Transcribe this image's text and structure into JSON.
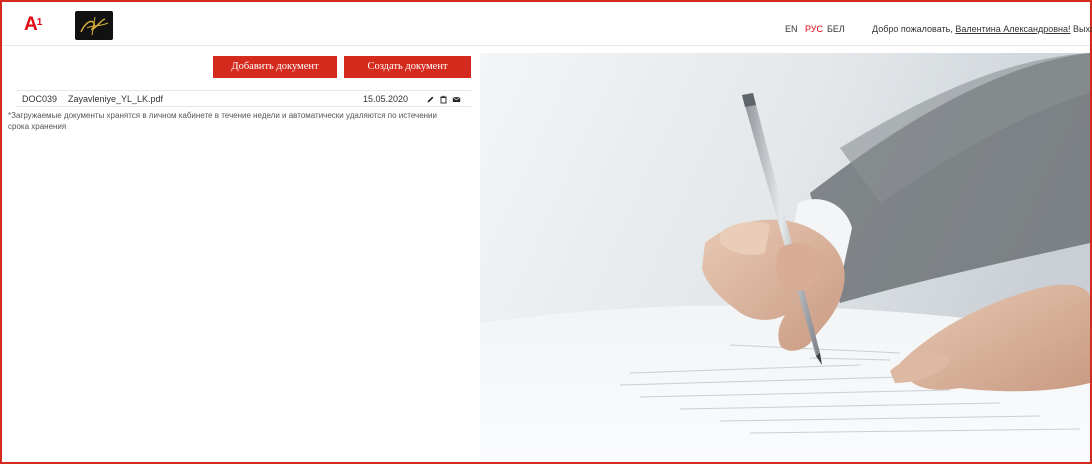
{
  "header": {
    "brand_logo": "A",
    "brand_logo_sup": "1",
    "languages": [
      "EN",
      "РУС",
      "БЕЛ"
    ],
    "active_language": "РУС",
    "welcome_prefix": "Добро пожаловать,",
    "user_name": "Валентина Александровна!",
    "logout_label": "Выход"
  },
  "toolbar": {
    "add_label": "Добавить документ",
    "create_label": "Создать документ"
  },
  "documents": [
    {
      "id": "DOC039",
      "name": "Zayavleniye_YL_LK.pdf",
      "date": "15.05.2020",
      "actions": [
        "pencil-icon",
        "trash-icon",
        "envelope-icon"
      ]
    }
  ],
  "note": "*Загружаемые документы хранятся в личном кабинете в течение недели и автоматически удаляются по истечении срока хранения",
  "colors": {
    "accent": "#d52b1e",
    "brand_red": "#e30613"
  }
}
